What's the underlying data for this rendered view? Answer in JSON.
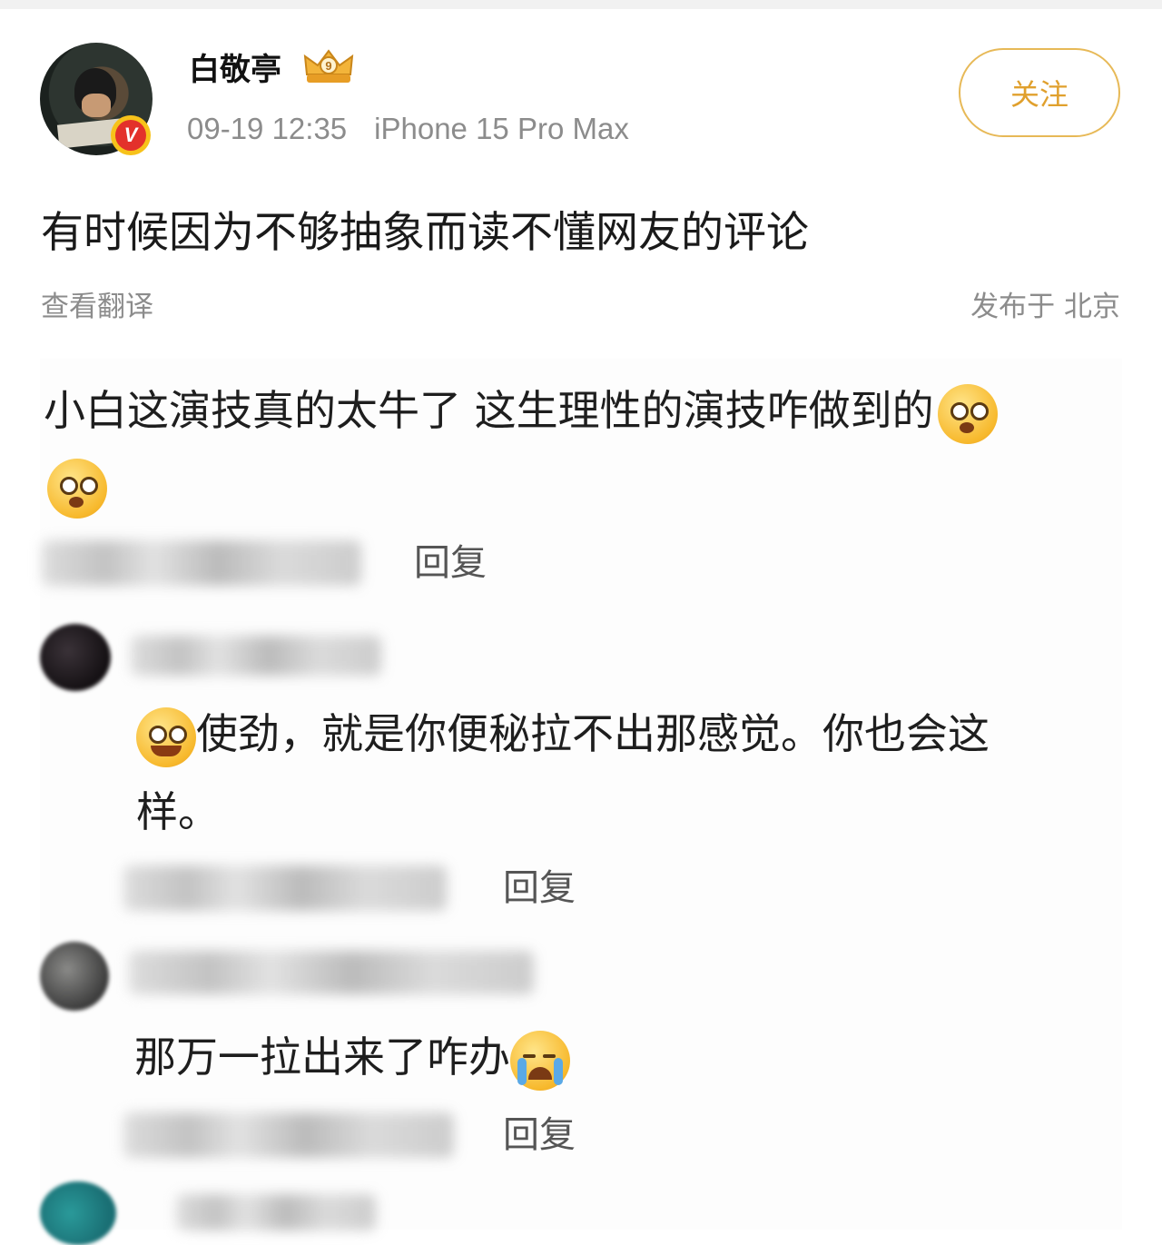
{
  "header": {
    "username": "白敬亭",
    "timestamp": "09-19 12:35",
    "device": "iPhone 15 Pro Max",
    "follow_label": "关注",
    "badge_letter": "V",
    "crown_number": "9"
  },
  "post": {
    "text": "有时候因为不够抽象而读不懂网友的评论",
    "translate_label": "查看翻译",
    "location": "发布于 北京"
  },
  "comments": {
    "top": {
      "line1": "小白这演技真的太牛了 这生理性的演技咋做到的",
      "emoji": "shocked-face-icon",
      "reply_label": "回复"
    },
    "first_reply": {
      "line1": "使劲，就是你便秘拉不出那感觉。你也会这",
      "line2": "样。",
      "emoji": "grin-face-icon",
      "reply_label": "回复"
    },
    "second_reply": {
      "text": "那万一拉出来了咋办",
      "emoji": "crying-face-icon",
      "reply_label": "回复"
    }
  },
  "colors": {
    "follow_border": "#e7b957",
    "follow_text": "#e0a02d",
    "verified_badge": "#e3312b",
    "meta_text": "#8c8c8c"
  }
}
